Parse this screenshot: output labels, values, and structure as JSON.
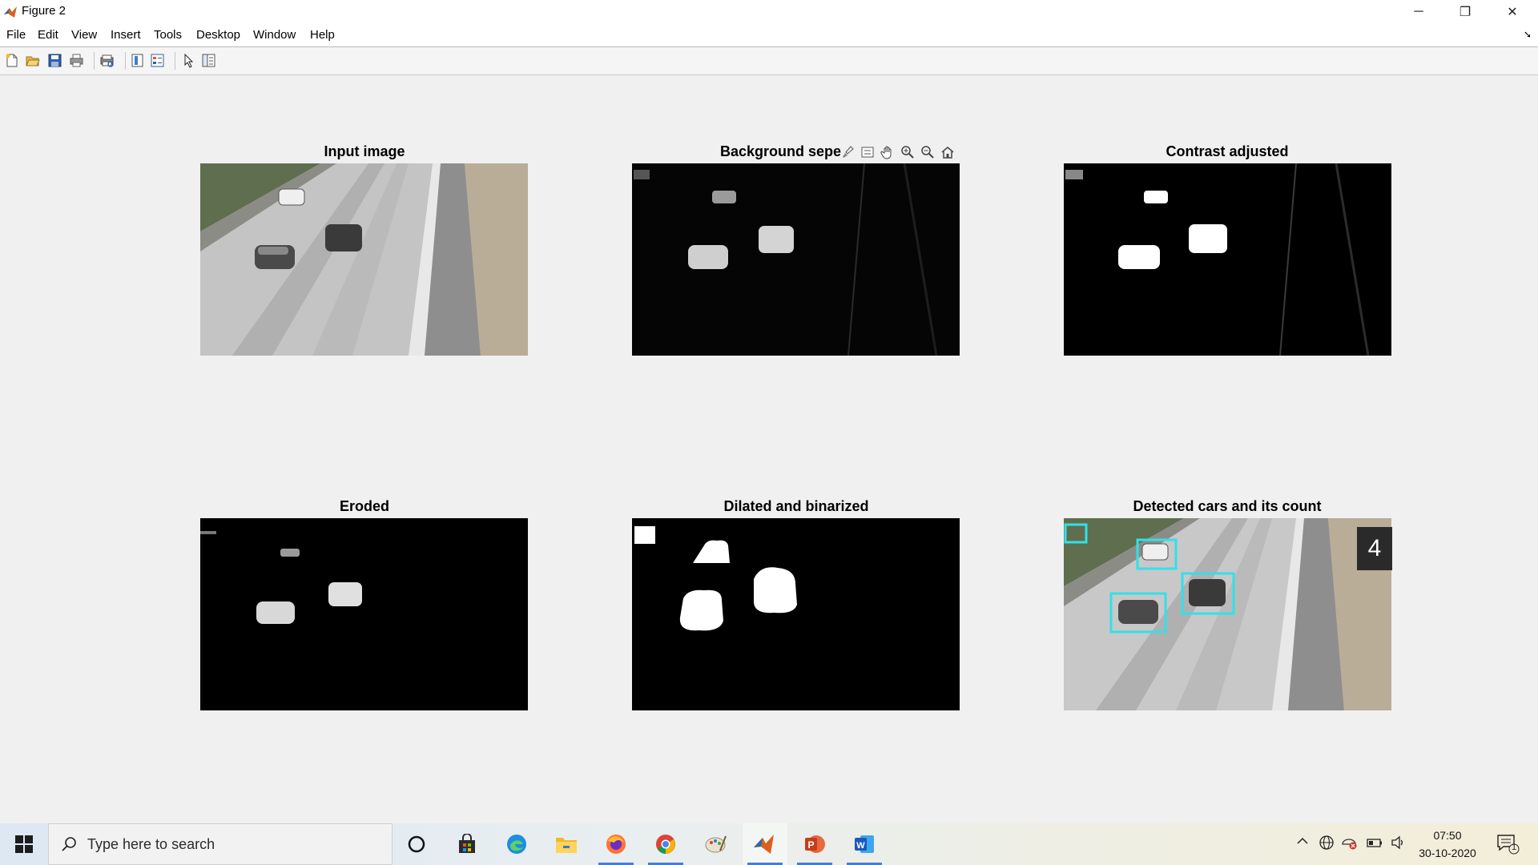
{
  "window": {
    "title": "Figure 2",
    "controls": {
      "minimize": "─",
      "maximize": "❐",
      "close": "✕"
    }
  },
  "menubar": {
    "items": [
      "File",
      "Edit",
      "View",
      "Insert",
      "Tools",
      "Desktop",
      "Window",
      "Help"
    ],
    "corner_glyph": "➘"
  },
  "toolbar": {
    "icons": [
      "new-figure-icon",
      "open-file-icon",
      "save-figure-icon",
      "print-figure-icon",
      "print-preview-icon",
      "colorbar-icon",
      "legend-icon",
      "edit-plot-icon",
      "property-inspector-icon"
    ]
  },
  "figure": {
    "plots": [
      {
        "title": "Input image"
      },
      {
        "title": "Background sepe"
      },
      {
        "title": "Contrast adjusted"
      },
      {
        "title": "Eroded"
      },
      {
        "title": "Dilated and binarized"
      },
      {
        "title": "Detected cars and its count"
      }
    ],
    "axes_toolbar": [
      "brush-icon",
      "data-tips-icon",
      "pan-icon",
      "zoom-in-icon",
      "zoom-out-icon",
      "restore-view-icon"
    ],
    "car_count": "4",
    "box_color": "#33e0e8"
  },
  "taskbar": {
    "search_placeholder": "Type here to search",
    "apps": [
      "cortana-icon",
      "store-icon",
      "edge-icon",
      "file-explorer-icon",
      "firefox-icon",
      "chrome-icon",
      "paint-icon",
      "matlab-icon",
      "powerpoint-icon",
      "word-icon"
    ],
    "clock": {
      "time": "07:50",
      "date": "30-10-2020"
    },
    "notification_count": "1"
  }
}
